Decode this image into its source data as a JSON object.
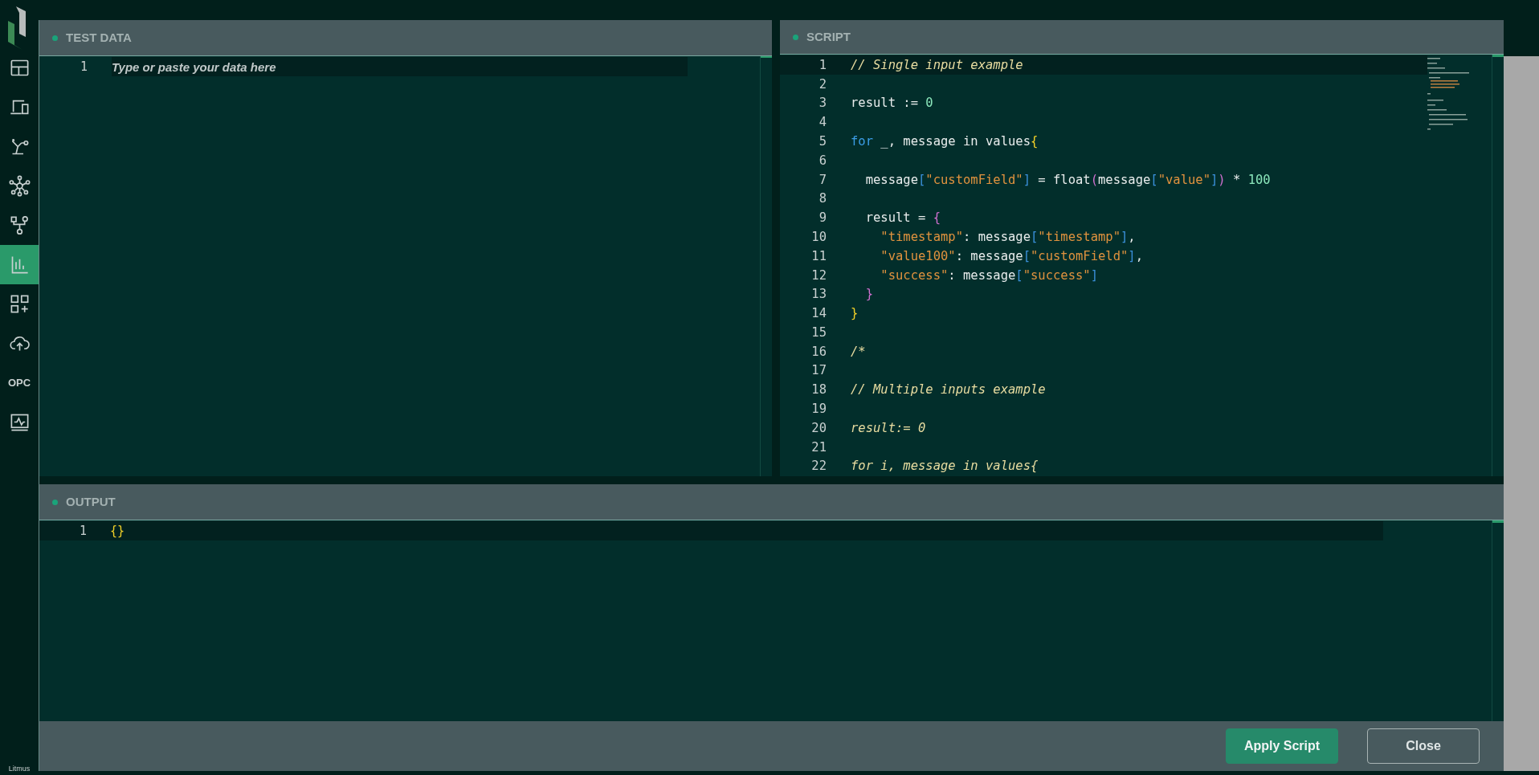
{
  "sidebar": {
    "items": [
      {
        "kind": "icon",
        "selected": false
      },
      {
        "kind": "icon",
        "selected": false
      },
      {
        "kind": "icon",
        "selected": false
      },
      {
        "kind": "icon",
        "selected": false
      },
      {
        "kind": "icon",
        "selected": false
      },
      {
        "kind": "icon",
        "selected": true
      },
      {
        "kind": "icon",
        "selected": false
      },
      {
        "kind": "icon",
        "selected": false
      },
      {
        "kind": "text",
        "label": "OPC",
        "selected": false
      },
      {
        "kind": "icon",
        "selected": false
      }
    ],
    "footer": "Litmus"
  },
  "test_data": {
    "title": "TEST DATA",
    "line_numbers": [
      "1"
    ],
    "placeholder": "Type or paste your data here"
  },
  "script": {
    "title": "SCRIPT",
    "lines": [
      {
        "number": "1",
        "tokens": [
          {
            "kind": "comment",
            "text": "// Single input example"
          }
        ]
      },
      {
        "number": "2"
      },
      {
        "number": "3",
        "tokens": [
          {
            "kind": "plain",
            "text": "result := "
          },
          {
            "kind": "number",
            "text": "0"
          }
        ]
      },
      {
        "number": "4"
      },
      {
        "number": "5",
        "tokens": [
          {
            "kind": "keyword",
            "text": "for"
          },
          {
            "kind": "plain",
            "text": " _, message in values"
          },
          {
            "kind": "brace",
            "text": "{"
          }
        ]
      },
      {
        "number": "6"
      },
      {
        "number": "7",
        "tokens": [
          {
            "kind": "plain",
            "text": "  message"
          },
          {
            "kind": "bracket",
            "text": "["
          },
          {
            "kind": "string",
            "text": "\"customField\""
          },
          {
            "kind": "bracket",
            "text": "]"
          },
          {
            "kind": "plain",
            "text": " = float"
          },
          {
            "kind": "paren",
            "text": "("
          },
          {
            "kind": "plain",
            "text": "message"
          },
          {
            "kind": "bracket",
            "text": "["
          },
          {
            "kind": "string",
            "text": "\"value\""
          },
          {
            "kind": "bracket",
            "text": "]"
          },
          {
            "kind": "paren",
            "text": ")"
          },
          {
            "kind": "plain",
            "text": " * "
          },
          {
            "kind": "number",
            "text": "100"
          }
        ]
      },
      {
        "number": "8"
      },
      {
        "number": "9",
        "tokens": [
          {
            "kind": "plain",
            "text": "  result = "
          },
          {
            "kind": "paren",
            "text": "{"
          }
        ]
      },
      {
        "number": "10",
        "tokens": [
          {
            "kind": "string",
            "text": "    \"timestamp\""
          },
          {
            "kind": "plain",
            "text": ": message"
          },
          {
            "kind": "bracket",
            "text": "["
          },
          {
            "kind": "string",
            "text": "\"timestamp\""
          },
          {
            "kind": "bracket",
            "text": "]"
          },
          {
            "kind": "plain",
            "text": ","
          }
        ]
      },
      {
        "number": "11",
        "tokens": [
          {
            "kind": "string",
            "text": "    \"value100\""
          },
          {
            "kind": "plain",
            "text": ": message"
          },
          {
            "kind": "bracket",
            "text": "["
          },
          {
            "kind": "string",
            "text": "\"customField\""
          },
          {
            "kind": "bracket",
            "text": "]"
          },
          {
            "kind": "plain",
            "text": ","
          }
        ]
      },
      {
        "number": "12",
        "tokens": [
          {
            "kind": "string",
            "text": "    \"success\""
          },
          {
            "kind": "plain",
            "text": ": message"
          },
          {
            "kind": "bracket",
            "text": "["
          },
          {
            "kind": "string",
            "text": "\"success\""
          },
          {
            "kind": "bracket",
            "text": "]"
          }
        ]
      },
      {
        "number": "13",
        "tokens": [
          {
            "kind": "paren",
            "text": "  }"
          }
        ]
      },
      {
        "number": "14",
        "tokens": [
          {
            "kind": "brace",
            "text": "}"
          }
        ]
      },
      {
        "number": "15"
      },
      {
        "number": "16",
        "tokens": [
          {
            "kind": "comment",
            "text": "/*"
          }
        ]
      },
      {
        "number": "17"
      },
      {
        "number": "18",
        "tokens": [
          {
            "kind": "comment",
            "text": "// Multiple inputs example"
          }
        ]
      },
      {
        "number": "19"
      },
      {
        "number": "20",
        "tokens": [
          {
            "kind": "comment",
            "text": "result:= 0"
          }
        ]
      },
      {
        "number": "21"
      },
      {
        "number": "22",
        "tokens": [
          {
            "kind": "comment",
            "text": "for i, message in values{"
          }
        ]
      }
    ]
  },
  "output": {
    "title": "OUTPUT",
    "lines": [
      {
        "number": "1",
        "text": "{}"
      }
    ]
  },
  "buttons": [
    {
      "kind": "primary",
      "label": "Apply Script"
    },
    {
      "kind": "secondary",
      "label": "Close"
    }
  ]
}
